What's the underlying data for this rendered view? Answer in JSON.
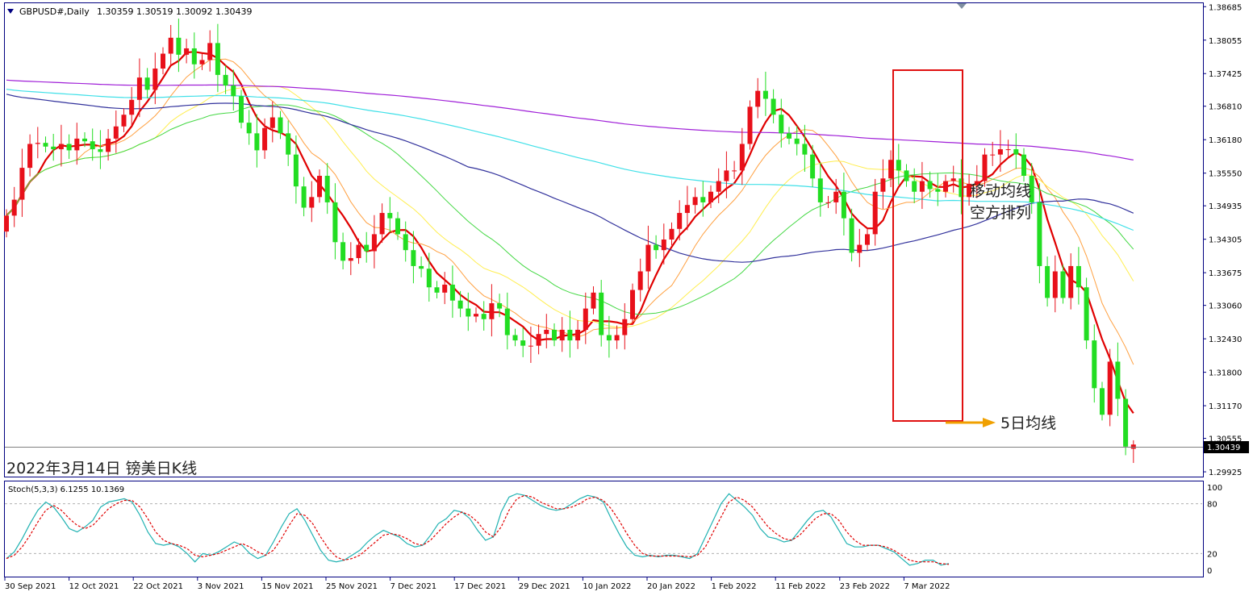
{
  "header": {
    "symbol_label": "GBPUSD#,Daily",
    "ohlc_label": "1.30359 1.30519 1.30092 1.30439"
  },
  "annotations": {
    "caption": "2022年3月14日 镑美日K线",
    "box_label_line1": "移动均线",
    "box_label_line2": "空方排列",
    "arrow_label": "5日均线"
  },
  "price_axis": {
    "ticks": [
      "1.38685",
      "1.38055",
      "1.37425",
      "1.36810",
      "1.36180",
      "1.35550",
      "1.34935",
      "1.34305",
      "1.33675",
      "1.33060",
      "1.32430",
      "1.31800",
      "1.31170",
      "1.30555",
      "1.29925"
    ],
    "current_price_label": "1.30439"
  },
  "stoch": {
    "label": "Stoch(5,3,3) 6.1255 10.1369",
    "ticks": [
      "100",
      "80",
      "20",
      "0"
    ]
  },
  "date_axis": {
    "labels": [
      "30 Sep 2021",
      "12 Oct 2021",
      "22 Oct 2021",
      "3 Nov 2021",
      "15 Nov 2021",
      "25 Nov 2021",
      "7 Dec 2021",
      "17 Dec 2021",
      "29 Dec 2021",
      "10 Jan 2022",
      "20 Jan 2022",
      "1 Feb 2022",
      "11 Feb 2022",
      "23 Feb 2022",
      "7 Mar 2022"
    ]
  },
  "chart_data": {
    "type": "candlestick",
    "symbol": "GBPUSD#",
    "timeframe": "Daily",
    "ylim": [
      1.2985,
      1.3875
    ],
    "last": {
      "open": 1.30359,
      "high": 1.30519,
      "low": 1.30092,
      "close": 1.30439
    },
    "colors": {
      "up": "#e8101a",
      "down": "#22dd22",
      "ma5": "#e00000",
      "ma10": "#ffa040",
      "ma20": "#ffee50",
      "ma30": "#44d844",
      "ma60": "#32329c",
      "ma120": "#40e0e8",
      "ma250": "#a020d8",
      "stoch_main": "#20b2b2",
      "stoch_signal": "#e00000",
      "annotation_box": "#e01010",
      "arrow": "#f0a000"
    },
    "closes": [
      1.3475,
      1.3505,
      1.3565,
      1.361,
      1.3612,
      1.3605,
      1.36,
      1.361,
      1.3598,
      1.362,
      1.3615,
      1.36,
      1.3595,
      1.362,
      1.3643,
      1.3665,
      1.3693,
      1.3735,
      1.3712,
      1.3752,
      1.378,
      1.381,
      1.3778,
      1.379,
      1.376,
      1.3768,
      1.38,
      1.374,
      1.372,
      1.37,
      1.365,
      1.363,
      1.3598,
      1.364,
      1.366,
      1.363,
      1.359,
      1.353,
      1.349,
      1.351,
      1.355,
      1.35,
      1.3425,
      1.339,
      1.3395,
      1.342,
      1.3408,
      1.344,
      1.348,
      1.347,
      1.344,
      1.341,
      1.338,
      1.3375,
      1.334,
      1.333,
      1.3345,
      1.3315,
      1.33,
      1.3285,
      1.329,
      1.328,
      1.331,
      1.33,
      1.325,
      1.324,
      1.323,
      1.323,
      1.3252,
      1.326,
      1.324,
      1.326,
      1.324,
      1.326,
      1.33,
      1.333,
      1.325,
      1.324,
      1.325,
      1.328,
      1.3335,
      1.337,
      1.342,
      1.341,
      1.343,
      1.345,
      1.348,
      1.3495,
      1.351,
      1.35,
      1.352,
      1.354,
      1.356,
      1.356,
      1.361,
      1.368,
      1.371,
      1.3695,
      1.3665,
      1.363,
      1.362,
      1.361,
      1.359,
      1.3545,
      1.35,
      1.35,
      1.352,
      1.347,
      1.3405,
      1.342,
      1.344,
      1.352,
      1.3545,
      1.358,
      1.356,
      1.354,
      1.352,
      1.354,
      1.3525,
      1.352,
      1.354,
      1.3545,
      1.351,
      1.3535,
      1.354,
      1.359,
      1.359,
      1.36,
      1.36,
      1.359,
      1.355,
      1.35,
      1.338,
      1.332,
      1.337,
      1.332,
      1.338,
      1.334,
      1.324,
      1.315,
      1.31,
      1.32,
      1.313,
      1.304,
      1.3044
    ],
    "stoch_main": [
      14,
      22,
      38,
      56,
      72,
      82,
      76,
      64,
      50,
      46,
      52,
      60,
      76,
      82,
      84,
      86,
      82,
      66,
      46,
      32,
      30,
      32,
      28,
      20,
      10,
      20,
      18,
      22,
      28,
      34,
      30,
      20,
      14,
      18,
      34,
      52,
      68,
      74,
      60,
      42,
      24,
      12,
      10,
      12,
      18,
      24,
      34,
      42,
      48,
      44,
      40,
      32,
      28,
      30,
      42,
      56,
      62,
      72,
      70,
      62,
      48,
      36,
      40,
      70,
      88,
      92,
      90,
      84,
      78,
      74,
      72,
      74,
      80,
      86,
      90,
      88,
      82,
      62,
      44,
      28,
      18,
      16,
      18,
      16,
      18,
      18,
      16,
      14,
      20,
      40,
      60,
      80,
      92,
      84,
      76,
      66,
      50,
      40,
      38,
      34,
      36,
      48,
      60,
      70,
      72,
      64,
      48,
      32,
      28,
      28,
      30,
      30,
      26,
      22,
      14,
      6,
      8,
      12,
      12,
      6,
      8
    ],
    "stoch_signal": [
      14,
      18,
      28,
      42,
      58,
      72,
      78,
      72,
      62,
      54,
      50,
      54,
      64,
      74,
      80,
      84,
      84,
      76,
      62,
      46,
      36,
      32,
      30,
      26,
      18,
      16,
      18,
      20,
      24,
      28,
      32,
      28,
      22,
      18,
      24,
      38,
      54,
      68,
      66,
      56,
      40,
      26,
      16,
      12,
      14,
      18,
      26,
      34,
      42,
      44,
      42,
      38,
      32,
      30,
      36,
      46,
      56,
      64,
      70,
      66,
      58,
      46,
      40,
      52,
      72,
      86,
      90,
      88,
      82,
      78,
      74,
      74,
      76,
      80,
      86,
      88,
      84,
      74,
      60,
      44,
      30,
      20,
      17,
      17,
      17,
      17,
      17,
      16,
      18,
      28,
      46,
      64,
      82,
      88,
      84,
      76,
      64,
      52,
      44,
      38,
      36,
      42,
      52,
      62,
      68,
      68,
      60,
      46,
      36,
      30,
      30,
      30,
      28,
      24,
      18,
      12,
      10,
      10,
      10,
      8,
      7
    ]
  }
}
